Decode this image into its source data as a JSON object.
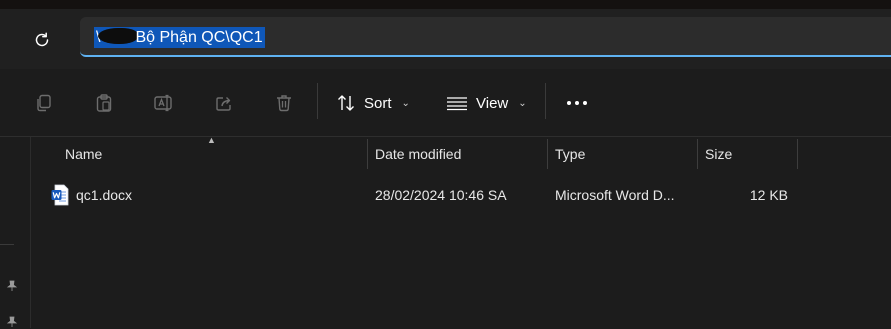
{
  "address_bar": {
    "path": "Bộ Phận QC\\QC1",
    "prefix_visible": "\\"
  },
  "toolbar": {
    "sort_label": "Sort",
    "view_label": "View",
    "icons": [
      "copy-icon",
      "paste-icon",
      "rename-icon",
      "share-icon",
      "delete-icon",
      "sort-icon",
      "view-icon",
      "more-icon"
    ]
  },
  "columns": [
    {
      "label": "Name"
    },
    {
      "label": "Date modified"
    },
    {
      "label": "Type"
    },
    {
      "label": "Size"
    }
  ],
  "files": [
    {
      "name": "qc1.docx",
      "date_modified": "28/02/2024 10:46 SA",
      "type": "Microsoft Word D...",
      "size": "12 KB",
      "icon": "word-document-icon"
    }
  ],
  "colors": {
    "background": "#1c1c1c",
    "accent": "#5fb2f2",
    "selection": "#0f57b8",
    "word_blue": "#185abd"
  }
}
